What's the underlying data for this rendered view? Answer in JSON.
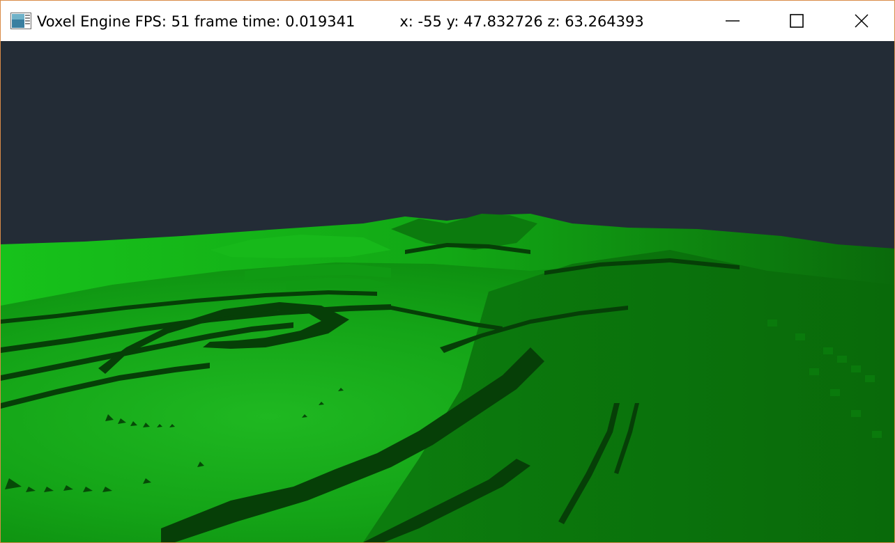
{
  "window": {
    "app_icon": "app-window-icon",
    "title": "Voxel Engine FPS: 51 frame time: 0.019341",
    "coords": "x: -55 y: 47.832726 z: 63.264393",
    "controls": {
      "minimize_icon": "minimize-icon",
      "maximize_icon": "maximize-icon",
      "close_icon": "close-icon"
    }
  },
  "scene": {
    "sky_color": "#232c36",
    "terrain_colors": {
      "bright": "#19b51f",
      "mid": "#0f8f13",
      "dark": "#0a5c0b",
      "ledge": "#063d07"
    }
  }
}
